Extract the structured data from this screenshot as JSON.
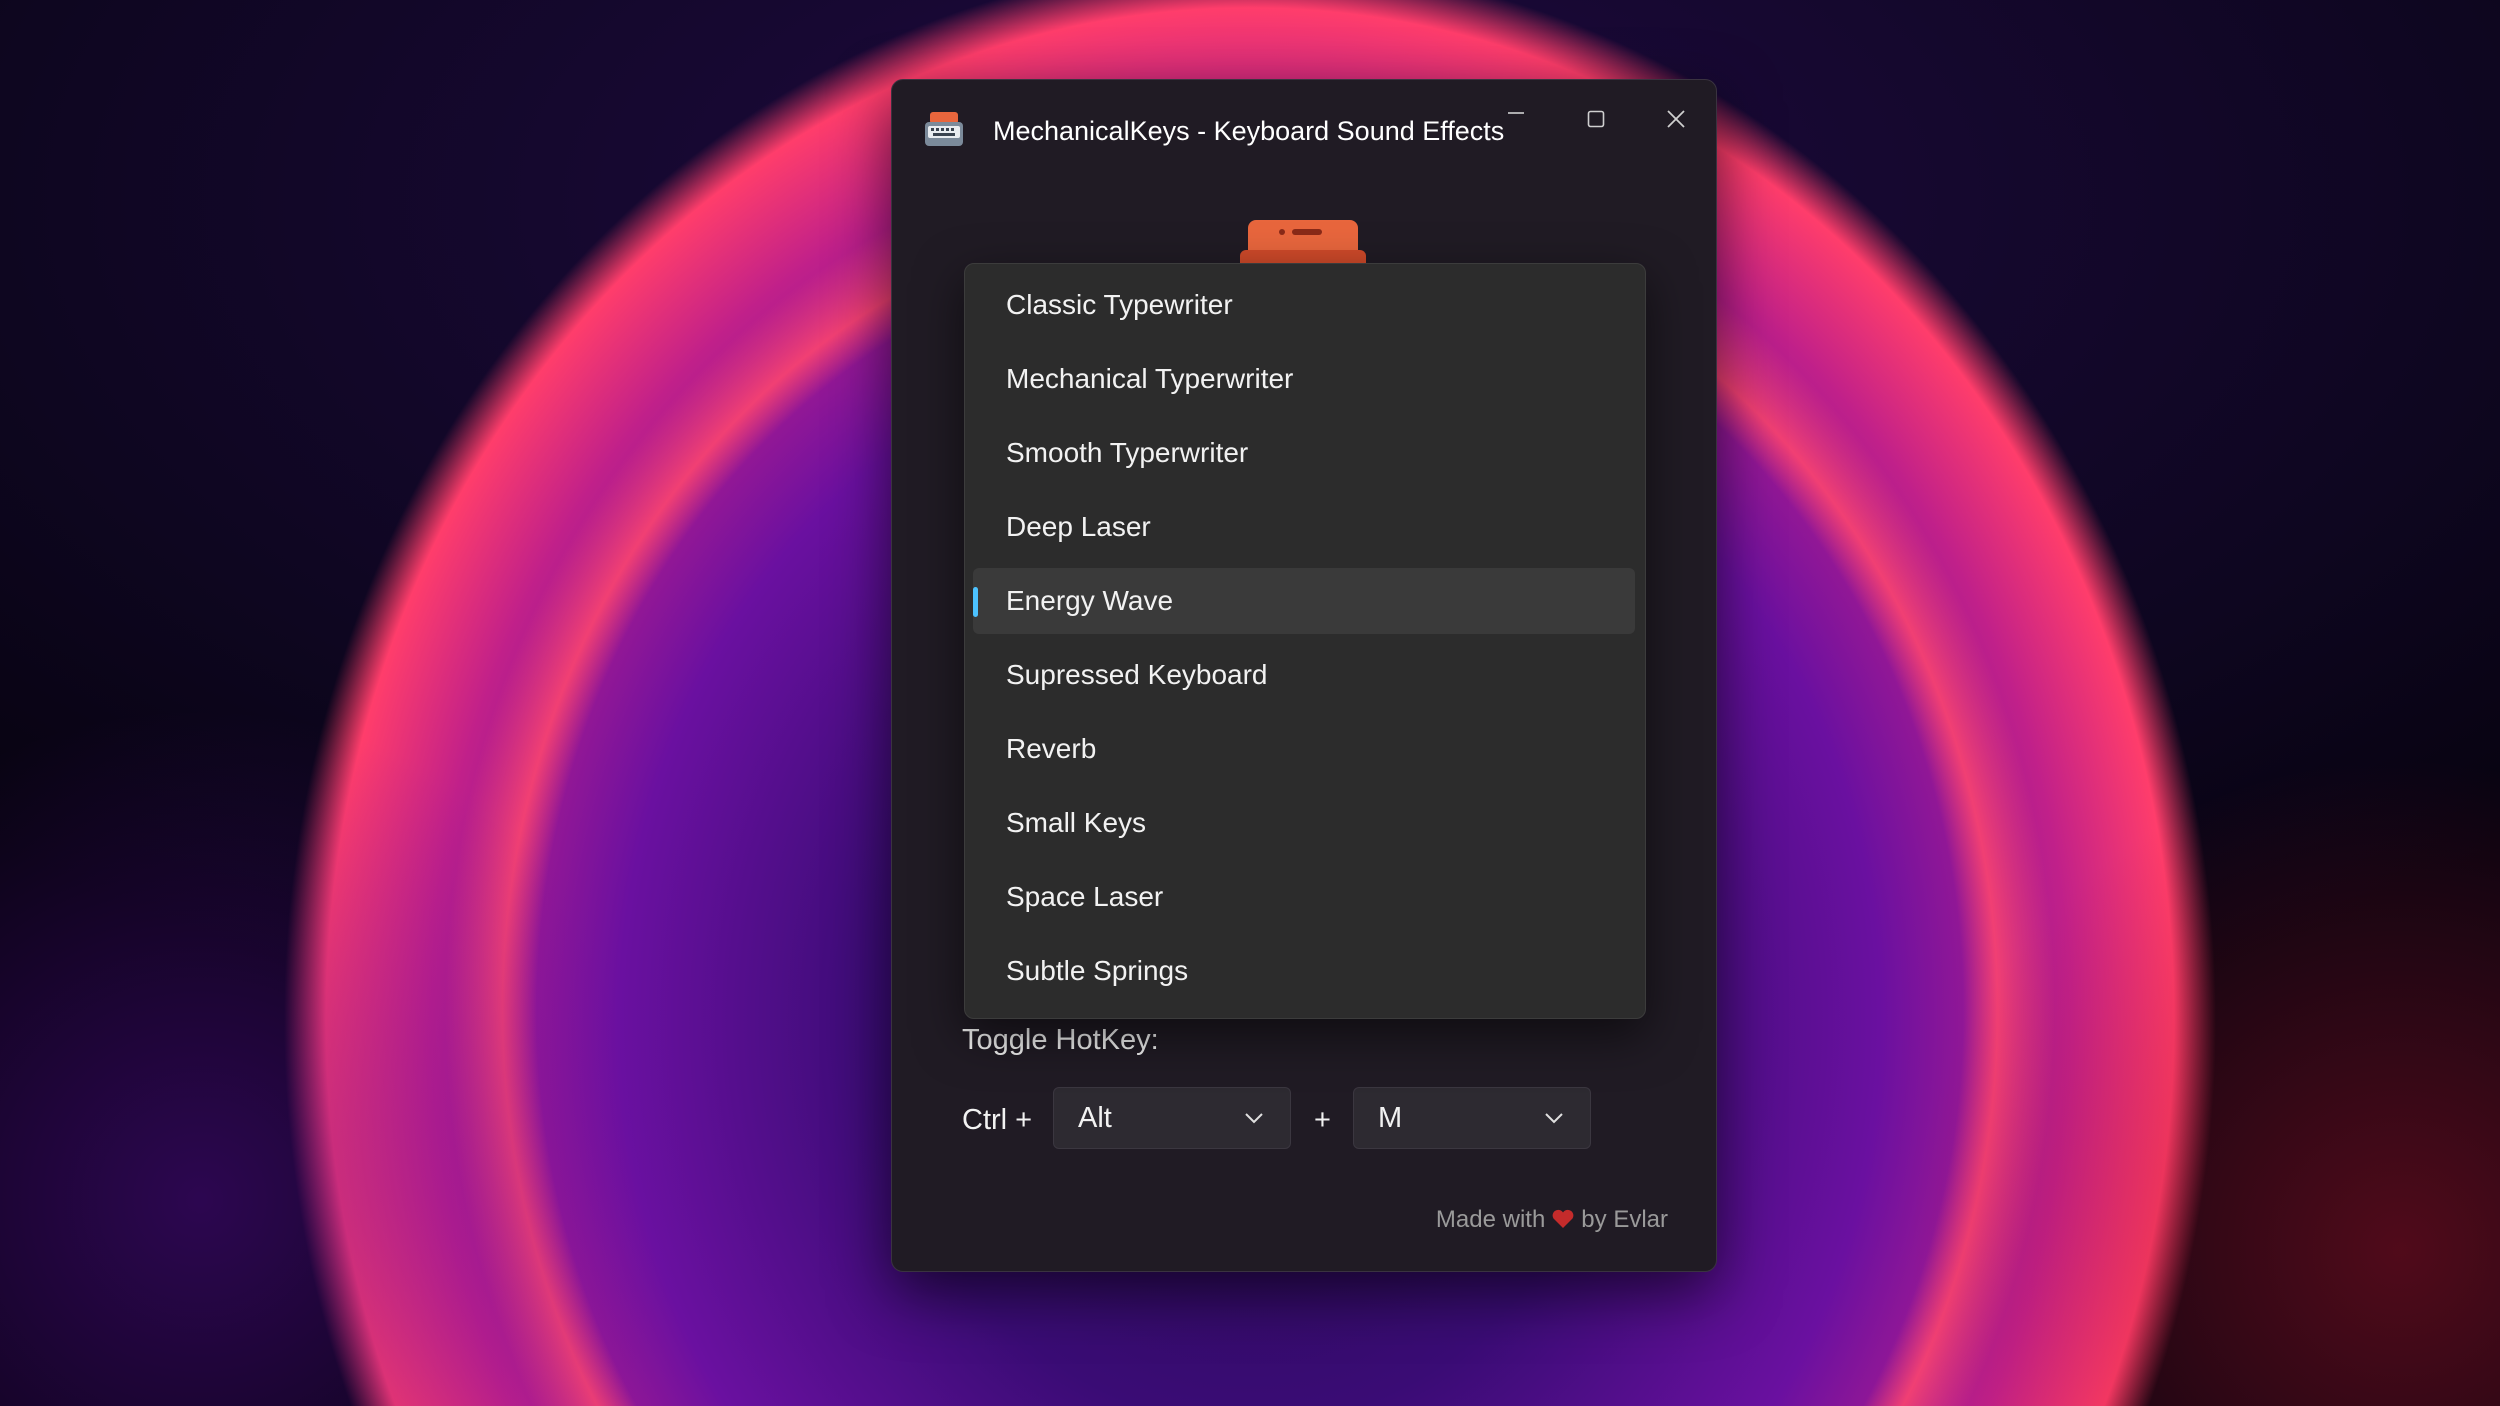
{
  "window": {
    "title": "MechanicalKeys - Keyboard Sound Effects"
  },
  "sound_dropdown": {
    "items": [
      {
        "label": "Classic Typewriter"
      },
      {
        "label": "Mechanical Typerwriter"
      },
      {
        "label": "Smooth Typerwriter"
      },
      {
        "label": "Deep Laser"
      },
      {
        "label": "Energy Wave"
      },
      {
        "label": "Supressed Keyboard"
      },
      {
        "label": "Reverb"
      },
      {
        "label": "Small Keys"
      },
      {
        "label": "Space Laser"
      },
      {
        "label": "Subtle Springs"
      }
    ],
    "selected": "Energy Wave"
  },
  "hotkey": {
    "label": "Toggle HotKey:",
    "ctrl_text": "Ctrl +",
    "plus_text": "+",
    "modifier_value": "Alt",
    "key_value": "M"
  },
  "footer": {
    "prefix": "Made with",
    "suffix": "by Evlar"
  },
  "icons": {
    "app": "typewriter-icon",
    "heart": "heart-icon",
    "accent_color": "#4cc2ff",
    "heart_color": "#c42b2b",
    "brand_color": "#e8663d"
  }
}
